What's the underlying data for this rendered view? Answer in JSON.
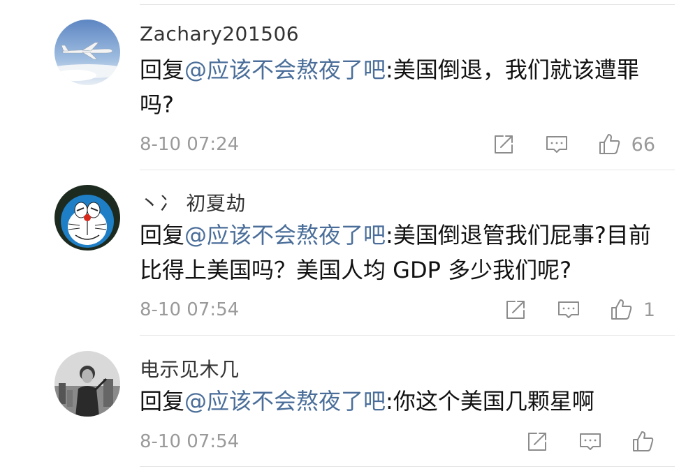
{
  "comments": [
    {
      "username": "Zachary201506",
      "reply_prefix": "回复",
      "mention": "@应该不会熬夜了吧",
      "text": ":美国倒退，我们就该遭罪吗?",
      "time": "8-10 07:24",
      "like_count": "66",
      "avatar_icon": "airplane-sky-avatar"
    },
    {
      "username": "丶冫 初夏劫",
      "reply_prefix": "回复",
      "mention": "@应该不会熬夜了吧",
      "text": ":美国倒退管我们屁事?目前比得上美国吗？美国人均 GDP 多少我们呢?",
      "time": "8-10 07:54",
      "like_count": "1",
      "avatar_icon": "cartoon-cat-avatar"
    },
    {
      "username": "电示见木几",
      "reply_prefix": "回复",
      "mention": "@应该不会熬夜了吧",
      "text": ":你这个美国几颗星啊",
      "time": "8-10 07:54",
      "like_count": "",
      "avatar_icon": "person-bw-photo-avatar"
    }
  ],
  "colors": {
    "mention": "#4a6e99",
    "meta": "#9a9a9a",
    "divider": "#e6e6e6"
  },
  "icons": {
    "share": "share-icon",
    "comment": "comment-icon",
    "like": "thumbs-up-icon"
  }
}
